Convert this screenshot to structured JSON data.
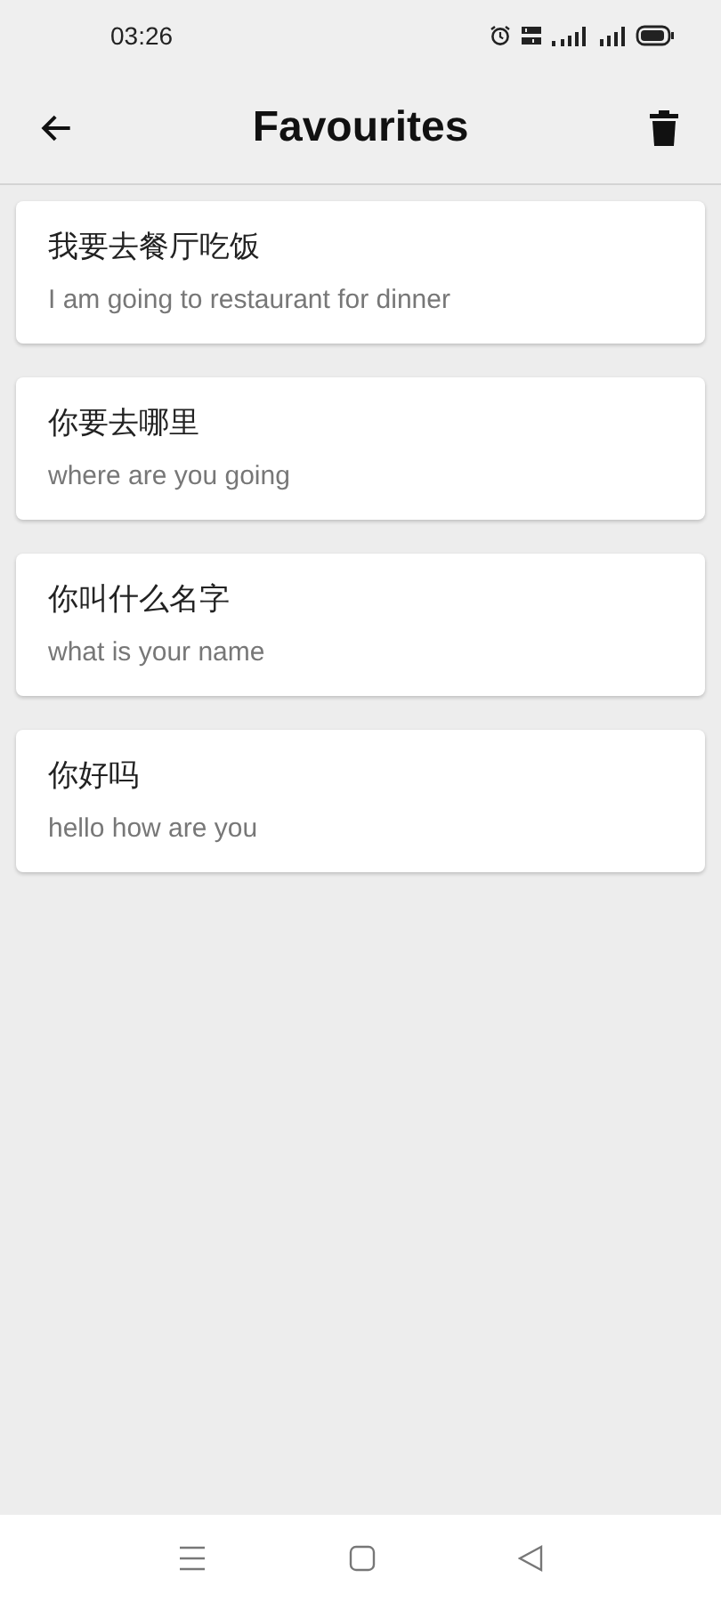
{
  "status_bar": {
    "time": "03:26"
  },
  "app_bar": {
    "title": "Favourites"
  },
  "favourites": [
    {
      "phrase": "我要去餐厅吃饭",
      "translation": "I am going to restaurant for dinner"
    },
    {
      "phrase": "你要去哪里",
      "translation": "where are you going"
    },
    {
      "phrase": "你叫什么名字",
      "translation": "what is your name"
    },
    {
      "phrase": "你好吗",
      "translation": "hello how are you"
    }
  ]
}
